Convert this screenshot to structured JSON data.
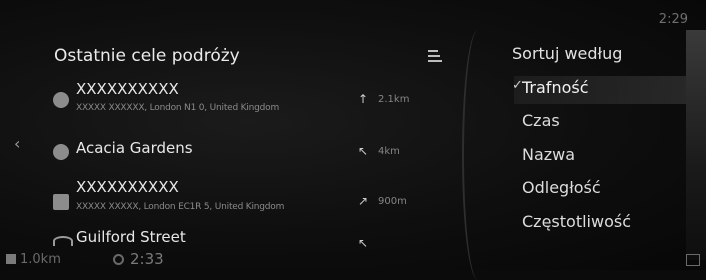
{
  "clock": "2:29",
  "left_panel": {
    "title": "Ostatnie cele podróży",
    "items": [
      {
        "title": "XXXXXXXXXX",
        "subtitle": "XXXXX XXXXXX, London N1 0, United Kingdom",
        "direction": "↑",
        "distance": "2.1km"
      },
      {
        "title": "Acacia Gardens",
        "subtitle": "",
        "direction": "↖",
        "distance": "4km"
      },
      {
        "title": "XXXXXXXXXX",
        "subtitle": "XXXXX XXXXX, London EC1R 5, United Kingdom",
        "direction": "↗",
        "distance": "900m"
      },
      {
        "title": "Guilford Street",
        "subtitle": "",
        "direction": "↖",
        "distance": ""
      }
    ]
  },
  "sort_panel": {
    "title": "Sortuj według",
    "options": [
      "Trafność",
      "Czas",
      "Nazwa",
      "Odległość",
      "Częstotliwość"
    ],
    "selected_index": 0,
    "check_mark": "✓"
  },
  "bottom_bar": {
    "distance": "1.0km",
    "time": "2:33"
  },
  "icons": {
    "back": "chevron-left-icon",
    "menu": "list-menu-icon",
    "clock": "clock-icon"
  }
}
